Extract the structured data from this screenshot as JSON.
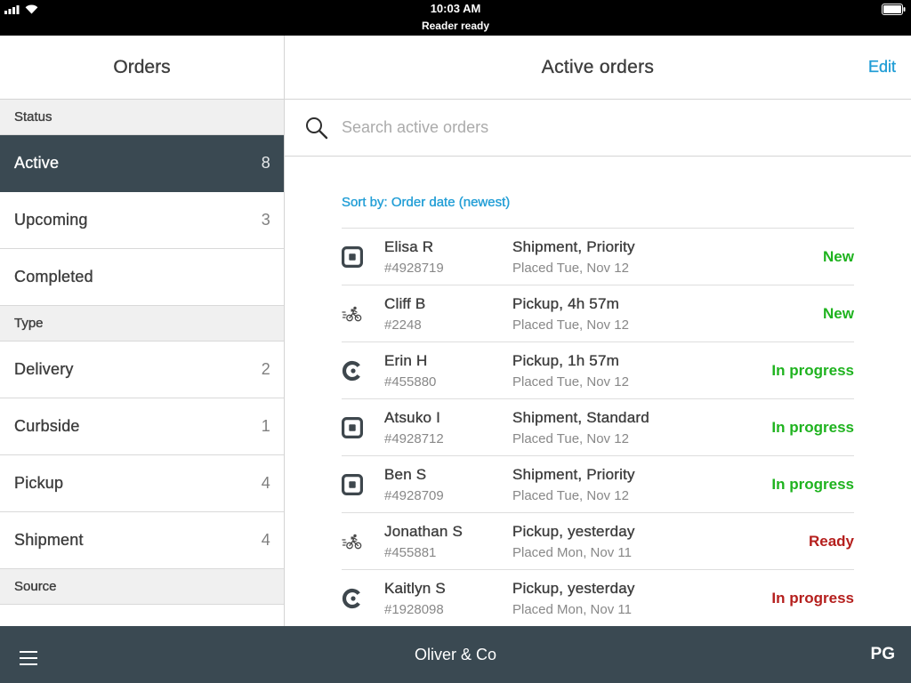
{
  "status_bar": {
    "time": "10:03 AM",
    "reader_status": "Reader ready",
    "icons": [
      "signal-icon",
      "wifi-icon",
      "battery-icon"
    ]
  },
  "sidebar": {
    "title": "Orders",
    "status_section": {
      "header": "Status",
      "items": [
        {
          "label": "Active",
          "count": 8,
          "selected": true
        },
        {
          "label": "Upcoming",
          "count": 3
        },
        {
          "label": "Completed"
        }
      ]
    },
    "type_section": {
      "header": "Type",
      "items": [
        {
          "label": "Delivery",
          "count": 2
        },
        {
          "label": "Curbside",
          "count": 1
        },
        {
          "label": "Pickup",
          "count": 4
        },
        {
          "label": "Shipment",
          "count": 4
        }
      ]
    },
    "source_section": {
      "header": "Source"
    }
  },
  "main": {
    "title": "Active orders",
    "edit_label": "Edit",
    "search": {
      "icon": "search-icon",
      "placeholder": "Search active orders",
      "value": ""
    },
    "sort": {
      "label": "Sort by:",
      "value": "Order date (newest)"
    },
    "orders": [
      {
        "source_icon": "square-logo-icon",
        "customer": "Elisa R",
        "order_number": "#4928719",
        "fulfillment": "Shipment, Priority",
        "placed": "Placed Tue, Nov 12",
        "status": "New",
        "status_color": "#1fb31f"
      },
      {
        "source_icon": "bicycle-courier-icon",
        "customer": "Cliff B",
        "order_number": "#2248",
        "fulfillment": "Pickup, 4h 57m",
        "placed": "Placed Tue, Nov 12",
        "status": "New",
        "status_color": "#1fb31f"
      },
      {
        "source_icon": "c-logo-icon",
        "customer": "Erin H",
        "order_number": "#455880",
        "fulfillment": "Pickup, 1h 57m",
        "placed": "Placed Tue, Nov 12",
        "status": "In progress",
        "status_color": "#1fb31f"
      },
      {
        "source_icon": "square-logo-icon",
        "customer": "Atsuko I",
        "order_number": "#4928712",
        "fulfillment": "Shipment, Standard",
        "placed": "Placed Tue, Nov 12",
        "status": "In progress",
        "status_color": "#1fb31f"
      },
      {
        "source_icon": "square-logo-icon",
        "customer": "Ben S",
        "order_number": "#4928709",
        "fulfillment": "Shipment, Priority",
        "placed": "Placed Tue, Nov 12",
        "status": "In progress",
        "status_color": "#1fb31f"
      },
      {
        "source_icon": "bicycle-courier-icon",
        "customer": "Jonathan S",
        "order_number": "#455881",
        "fulfillment": "Pickup, yesterday",
        "placed": "Placed Mon, Nov 11",
        "status": "Ready",
        "status_color": "#b51f1d"
      },
      {
        "source_icon": "c-logo-icon",
        "customer": "Kaitlyn S",
        "order_number": "#1928098",
        "fulfillment": "Pickup, yesterday",
        "placed": "Placed Mon, Nov 11",
        "status": "In progress",
        "status_color": "#b51f1d"
      }
    ]
  },
  "bottom_bar": {
    "menu_icon": "hamburger-menu-icon",
    "business_name": "Oliver & Co",
    "user_initials": "PG"
  },
  "colors": {
    "brand_dark": "#3a4952",
    "accent_blue": "#229ed6",
    "status_green": "#1fb31f",
    "status_red": "#b51f1d",
    "text_primary": "#3d3d3d",
    "text_secondary": "#888888",
    "section_background": "#f0f0f0"
  }
}
